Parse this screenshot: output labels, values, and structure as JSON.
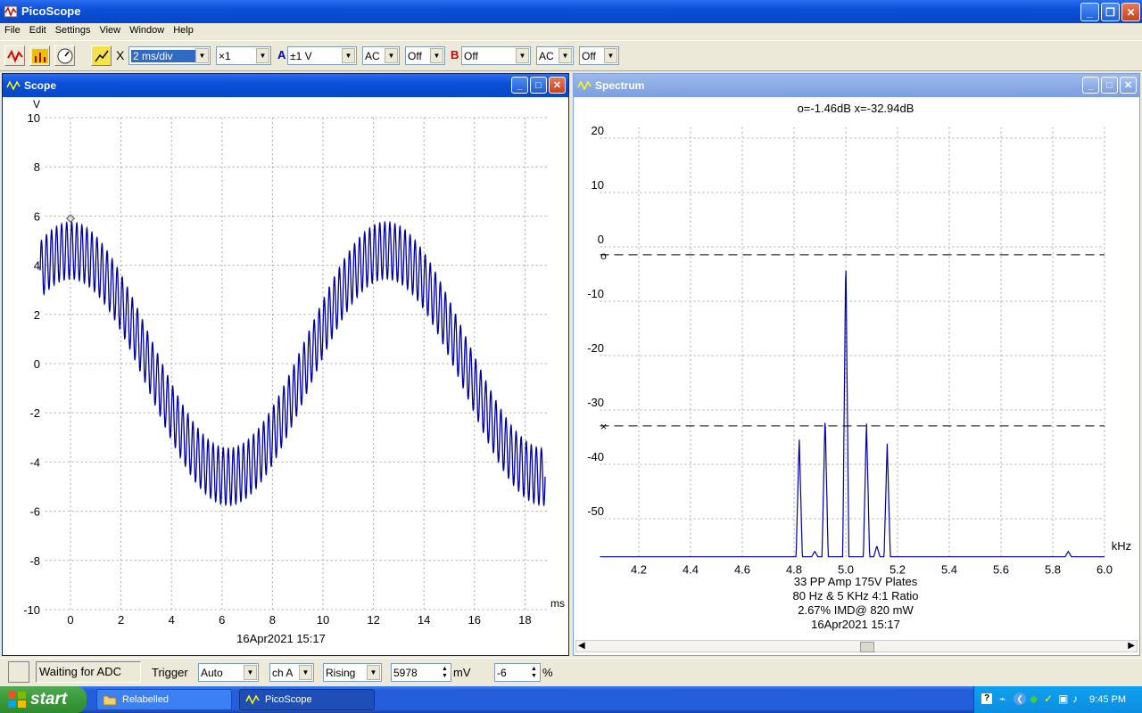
{
  "app": {
    "title": "PicoScope"
  },
  "menu": [
    "File",
    "Edit",
    "Settings",
    "View",
    "Window",
    "Help"
  ],
  "toolbar": {
    "x_label": "X",
    "timebase": "2 ms/div",
    "multiplier": "×1",
    "channel_a": {
      "label": "A",
      "range": "±1 V",
      "coupling": "AC",
      "option": "Off"
    },
    "channel_b": {
      "label": "B",
      "range": "Off",
      "coupling": "AC",
      "option": "Off"
    }
  },
  "scope": {
    "title": "Scope",
    "y_unit": "V",
    "x_unit": "ms",
    "y_ticks": [
      "10",
      "8",
      "6",
      "4",
      "2",
      "0",
      "-2",
      "-4",
      "-6",
      "-8",
      "-10"
    ],
    "x_ticks": [
      "0",
      "2",
      "4",
      "6",
      "8",
      "10",
      "12",
      "14",
      "16",
      "18"
    ],
    "timestamp": "16Apr2021  15:17"
  },
  "spectrum": {
    "title": "Spectrum",
    "readout": "o=-1.46dB  x=-32.94dB",
    "y_ticks": [
      "20",
      "10",
      "0",
      "-10",
      "-20",
      "-30",
      "-40",
      "-50"
    ],
    "x_ticks": [
      "4.2",
      "4.4",
      "4.6",
      "4.8",
      "5.0",
      "5.2",
      "5.4",
      "5.6",
      "5.8",
      "6.0"
    ],
    "x_unit": "kHz",
    "marker_o_label": "o",
    "marker_x_label": "×",
    "notes": [
      "33 PP Amp 175V Plates",
      "80 Hz & 5 KHz 4:1 Ratio",
      "2.67% IMD@ 820 mW",
      "16Apr2021  15:17"
    ]
  },
  "chart_data": [
    {
      "type": "line",
      "title": "",
      "xlabel": "ms",
      "ylabel": "V",
      "xlim": [
        -1,
        19
      ],
      "ylim": [
        -10,
        10
      ],
      "grid": true,
      "series": [
        {
          "description_values": "80 Hz sine amplitude ~4.6 V with 5 kHz component ~1.15 V superimposed",
          "low_freq_hz": 80,
          "low_amp": 4.6,
          "high_freq_hz": 5000,
          "high_amp": 1.15,
          "x_start": -1.2,
          "x_end": 18.8
        }
      ]
    },
    {
      "type": "line",
      "xlabel": "kHz",
      "ylabel": "dB",
      "xlim": [
        4.05,
        6.0
      ],
      "ylim": [
        -57,
        22
      ],
      "grid": true,
      "peaks": [
        {
          "x": 4.82,
          "y": -35
        },
        {
          "x": 4.88,
          "y": -56
        },
        {
          "x": 4.92,
          "y": -31
        },
        {
          "x": 5.0,
          "y": -1.46
        },
        {
          "x": 5.08,
          "y": -32
        },
        {
          "x": 5.12,
          "y": -55
        },
        {
          "x": 5.16,
          "y": -36
        },
        {
          "x": 5.86,
          "y": -56
        }
      ],
      "noise_floor": -57,
      "marker_o": -1.46,
      "marker_x": -32.94
    }
  ],
  "status": {
    "message": "Waiting for ADC",
    "trigger_label": "Trigger",
    "trigger_mode": "Auto",
    "trigger_channel": "ch A",
    "trigger_edge": "Rising",
    "threshold": "5978",
    "threshold_unit": "mV",
    "delay": "-6",
    "delay_unit": "%"
  },
  "taskbar": {
    "start": "start",
    "tasks": [
      "Relabelled",
      "PicoScope"
    ],
    "clock": "9:45 PM"
  },
  "colors": {
    "trace": "#0000a0",
    "titlebar": "#0a50d8"
  }
}
